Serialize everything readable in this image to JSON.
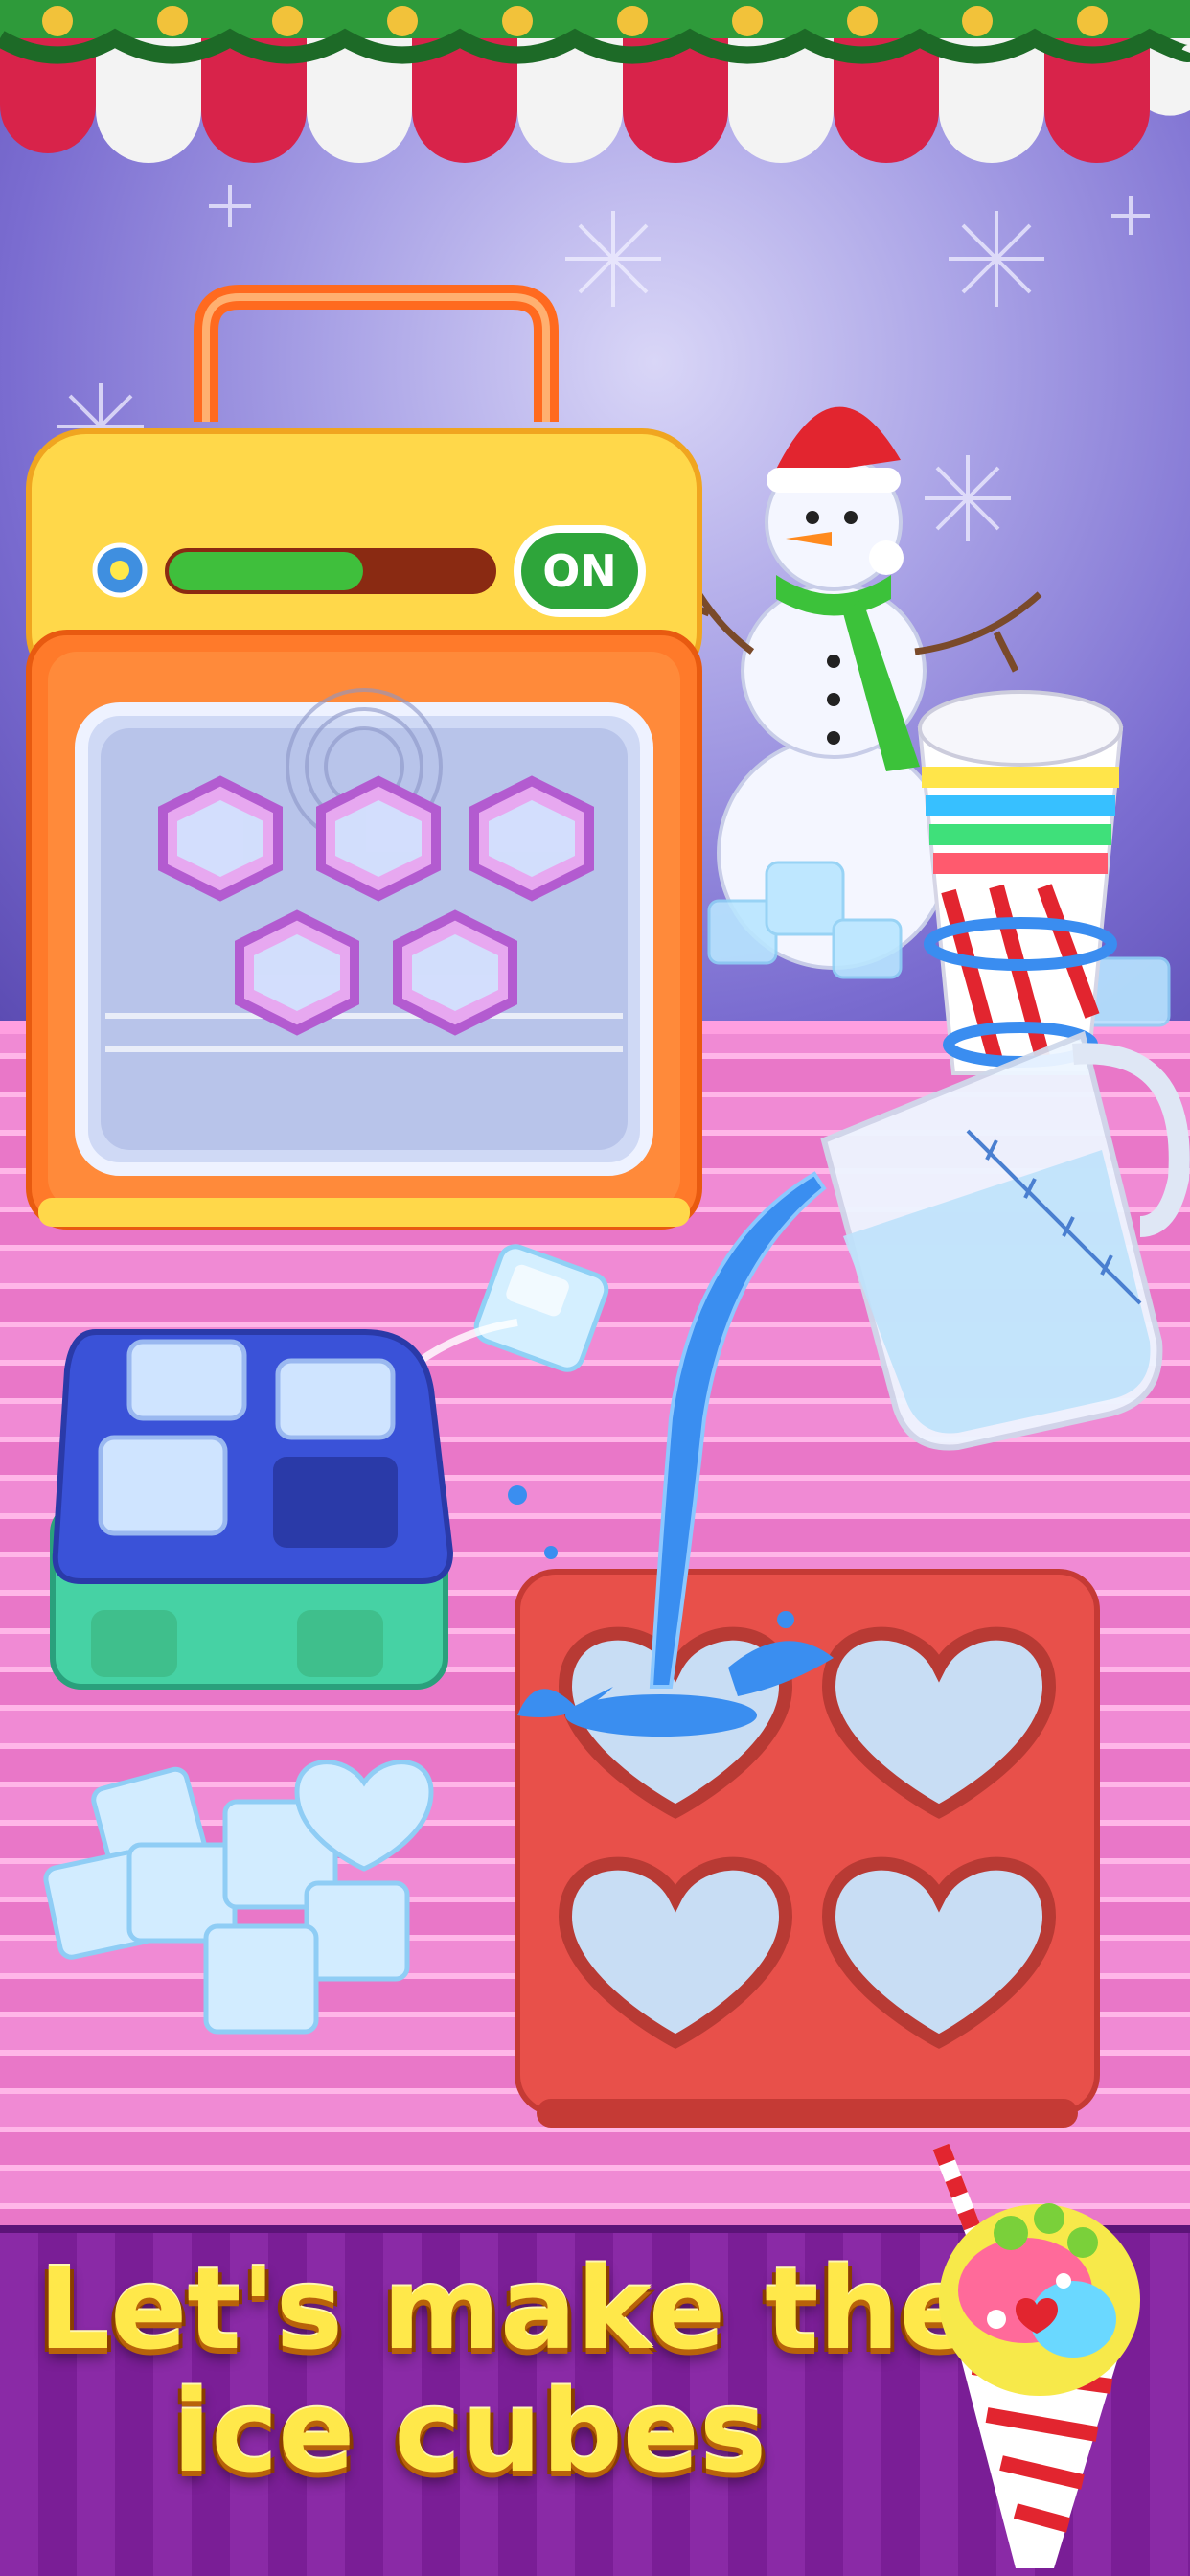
{
  "game": {
    "headline_line1": "Let's make the",
    "headline_line2": "ice cubes",
    "freezer": {
      "power_button_label": "ON",
      "progress": 0.6,
      "progress_color": "#3fbf3c"
    }
  },
  "colors": {
    "background_purple": "#7a6cd0",
    "table_pink": "#f08ad4",
    "banner_purple": "#8a2aa6",
    "headline_yellow": "#ffe84a",
    "freezer_orange": "#ff7a2a",
    "freezer_yellow": "#ffd84a",
    "heart_tray_red": "#e8504a",
    "square_tray_blue": "#3b4fd0",
    "square_tray_green": "#4fd7b0"
  },
  "icons": [
    "snowflake-icon",
    "power-button",
    "snowman",
    "paper-cups",
    "measuring-jug",
    "ice-cube",
    "snow-cone-icon"
  ]
}
